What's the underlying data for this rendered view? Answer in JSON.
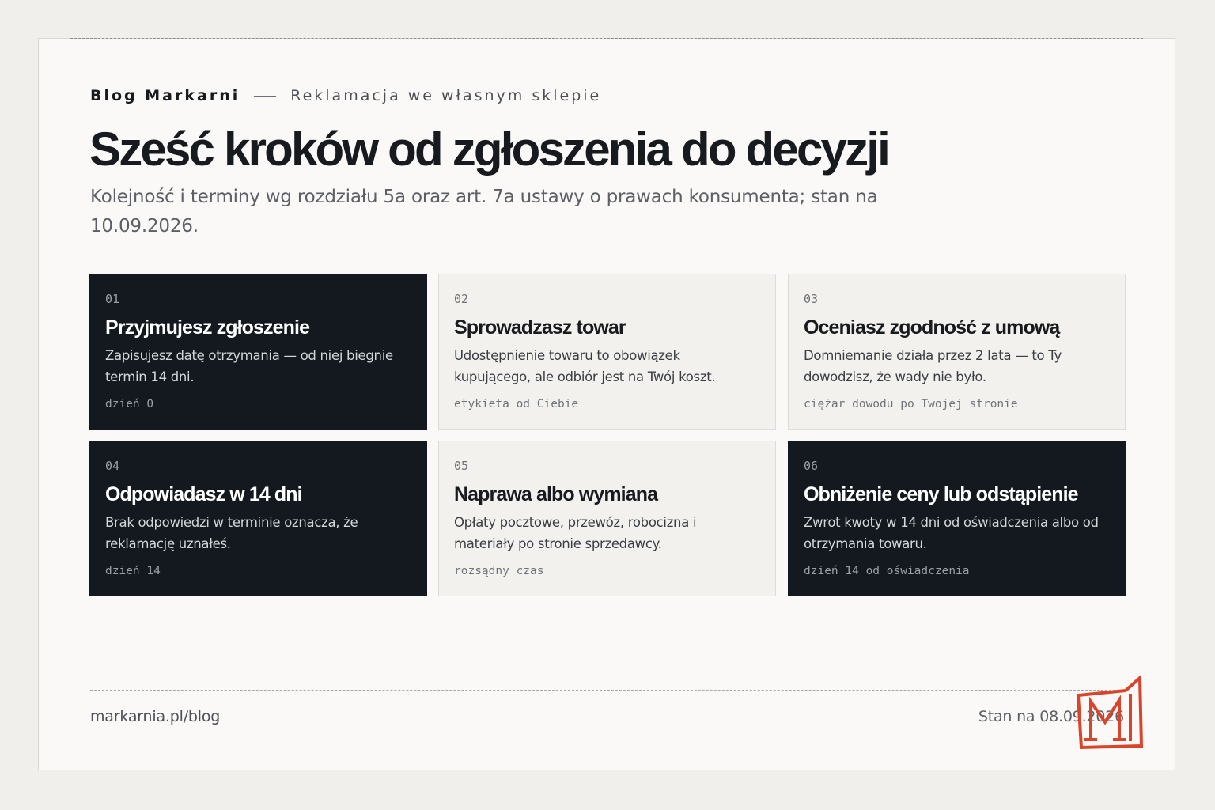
{
  "header": {
    "brand": "Blog Markarni",
    "topic": "Reklamacja we własnym sklepie",
    "title": "Sześć kroków od zgłoszenia do decyzji",
    "subtitle": "Kolejność i terminy wg rozdziału 5a oraz art. 7a ustawy o prawach konsumenta; stan na 10.09.2026."
  },
  "steps": [
    {
      "number": "01",
      "title": "Przyjmujesz zgłoszenie",
      "description": "Zapisujesz datę otrzymania — od niej biegnie termin 14 dni.",
      "tag": "dzień 0",
      "style": "dark"
    },
    {
      "number": "02",
      "title": "Sprowadzasz towar",
      "description": "Udostępnienie towaru to obowiązek kupującego, ale odbiór jest na Twój koszt.",
      "tag": "etykieta od Ciebie",
      "style": "light"
    },
    {
      "number": "03",
      "title": "Oceniasz zgodność z umową",
      "description": "Domniemanie działa przez 2 lata — to Ty dowodzisz, że wady nie było.",
      "tag": "ciężar dowodu po Twojej stronie",
      "style": "light"
    },
    {
      "number": "04",
      "title": "Odpowiadasz w 14 dni",
      "description": "Brak odpowiedzi w terminie oznacza, że reklamację uznałeś.",
      "tag": "dzień 14",
      "style": "dark"
    },
    {
      "number": "05",
      "title": "Naprawa albo wymiana",
      "description": "Opłaty pocztowe, przewóz, robocizna i materiały po stronie sprzedawcy.",
      "tag": "rozsądny czas",
      "style": "light"
    },
    {
      "number": "06",
      "title": "Obniżenie ceny lub odstąpienie",
      "description": "Zwrot kwoty w 14 dni od oświadczenia albo od otrzymania towaru.",
      "tag": "dzień 14 od oświadczenia",
      "style": "dark"
    }
  ],
  "footer": {
    "url": "markarnia.pl/blog",
    "status": "Stan na 08.09.2026"
  },
  "logo": {
    "icon": "markarnia-m-logo-icon",
    "color": "#d9452b"
  },
  "colors": {
    "dark_card": "#13191e",
    "light_card": "#f2f1ed",
    "page": "#faf9f7",
    "accent": "#d9452b"
  }
}
